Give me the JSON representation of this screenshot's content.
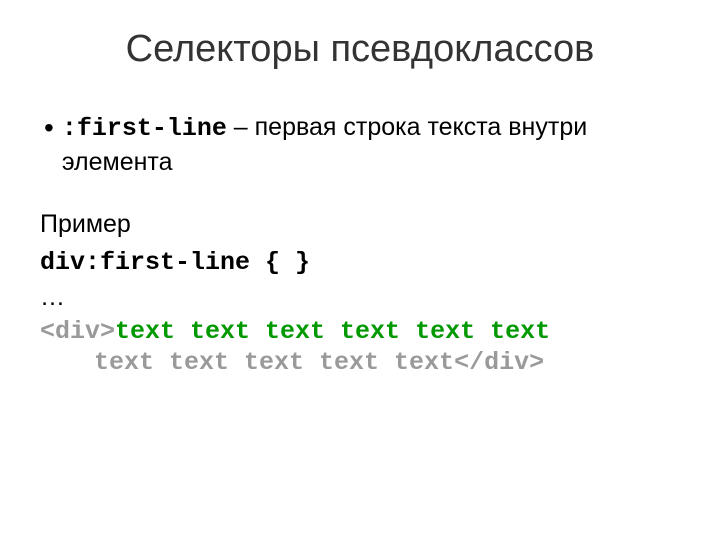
{
  "title": "Селекторы псевдоклассов",
  "bullet": {
    "dot": "•",
    "selector": ":first-line",
    "dash": " – ",
    "desc": "первая строка текста внутри элемента"
  },
  "example": {
    "label": "Пример",
    "rule": "div:first-line { }",
    "ellipsis": "…",
    "openTag": "<div>",
    "line1": "text text text text text text",
    "line2": "text text text text text",
    "closeTag": "</div>"
  }
}
